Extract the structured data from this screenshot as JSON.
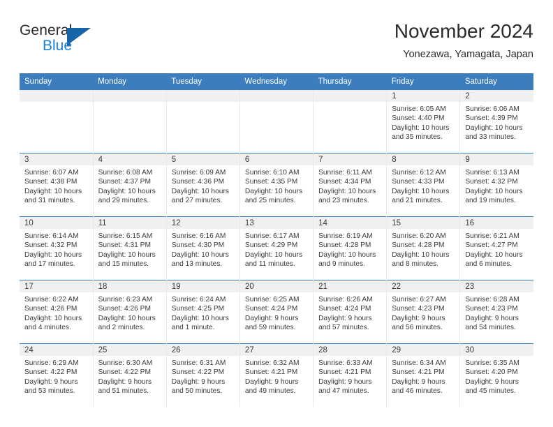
{
  "brand": {
    "name_top": "General",
    "name_bottom": "Blue",
    "mark": "triangle-logo"
  },
  "header": {
    "title": "November 2024",
    "subtitle": "Yonezawa, Yamagata, Japan"
  },
  "colors": {
    "header_blue": "#3b7dbd",
    "brand_blue": "#1b7fd4",
    "mark_blue": "#1565a8",
    "daynum_band": "#f0f0f0"
  },
  "weekday_headers": [
    "Sunday",
    "Monday",
    "Tuesday",
    "Wednesday",
    "Thursday",
    "Friday",
    "Saturday"
  ],
  "labels": {
    "sunrise_prefix": "Sunrise:",
    "sunset_prefix": "Sunset:",
    "daylight_prefix": "Daylight:"
  },
  "weeks": [
    [
      {
        "empty": true
      },
      {
        "empty": true
      },
      {
        "empty": true
      },
      {
        "empty": true
      },
      {
        "empty": true
      },
      {
        "day": "1",
        "sunrise": "Sunrise: 6:05 AM",
        "sunset": "Sunset: 4:40 PM",
        "daylight_1": "Daylight: 10 hours",
        "daylight_2": "and 35 minutes."
      },
      {
        "day": "2",
        "sunrise": "Sunrise: 6:06 AM",
        "sunset": "Sunset: 4:39 PM",
        "daylight_1": "Daylight: 10 hours",
        "daylight_2": "and 33 minutes."
      }
    ],
    [
      {
        "day": "3",
        "sunrise": "Sunrise: 6:07 AM",
        "sunset": "Sunset: 4:38 PM",
        "daylight_1": "Daylight: 10 hours",
        "daylight_2": "and 31 minutes."
      },
      {
        "day": "4",
        "sunrise": "Sunrise: 6:08 AM",
        "sunset": "Sunset: 4:37 PM",
        "daylight_1": "Daylight: 10 hours",
        "daylight_2": "and 29 minutes."
      },
      {
        "day": "5",
        "sunrise": "Sunrise: 6:09 AM",
        "sunset": "Sunset: 4:36 PM",
        "daylight_1": "Daylight: 10 hours",
        "daylight_2": "and 27 minutes."
      },
      {
        "day": "6",
        "sunrise": "Sunrise: 6:10 AM",
        "sunset": "Sunset: 4:35 PM",
        "daylight_1": "Daylight: 10 hours",
        "daylight_2": "and 25 minutes."
      },
      {
        "day": "7",
        "sunrise": "Sunrise: 6:11 AM",
        "sunset": "Sunset: 4:34 PM",
        "daylight_1": "Daylight: 10 hours",
        "daylight_2": "and 23 minutes."
      },
      {
        "day": "8",
        "sunrise": "Sunrise: 6:12 AM",
        "sunset": "Sunset: 4:33 PM",
        "daylight_1": "Daylight: 10 hours",
        "daylight_2": "and 21 minutes."
      },
      {
        "day": "9",
        "sunrise": "Sunrise: 6:13 AM",
        "sunset": "Sunset: 4:32 PM",
        "daylight_1": "Daylight: 10 hours",
        "daylight_2": "and 19 minutes."
      }
    ],
    [
      {
        "day": "10",
        "sunrise": "Sunrise: 6:14 AM",
        "sunset": "Sunset: 4:32 PM",
        "daylight_1": "Daylight: 10 hours",
        "daylight_2": "and 17 minutes."
      },
      {
        "day": "11",
        "sunrise": "Sunrise: 6:15 AM",
        "sunset": "Sunset: 4:31 PM",
        "daylight_1": "Daylight: 10 hours",
        "daylight_2": "and 15 minutes."
      },
      {
        "day": "12",
        "sunrise": "Sunrise: 6:16 AM",
        "sunset": "Sunset: 4:30 PM",
        "daylight_1": "Daylight: 10 hours",
        "daylight_2": "and 13 minutes."
      },
      {
        "day": "13",
        "sunrise": "Sunrise: 6:17 AM",
        "sunset": "Sunset: 4:29 PM",
        "daylight_1": "Daylight: 10 hours",
        "daylight_2": "and 11 minutes."
      },
      {
        "day": "14",
        "sunrise": "Sunrise: 6:19 AM",
        "sunset": "Sunset: 4:28 PM",
        "daylight_1": "Daylight: 10 hours",
        "daylight_2": "and 9 minutes."
      },
      {
        "day": "15",
        "sunrise": "Sunrise: 6:20 AM",
        "sunset": "Sunset: 4:28 PM",
        "daylight_1": "Daylight: 10 hours",
        "daylight_2": "and 8 minutes."
      },
      {
        "day": "16",
        "sunrise": "Sunrise: 6:21 AM",
        "sunset": "Sunset: 4:27 PM",
        "daylight_1": "Daylight: 10 hours",
        "daylight_2": "and 6 minutes."
      }
    ],
    [
      {
        "day": "17",
        "sunrise": "Sunrise: 6:22 AM",
        "sunset": "Sunset: 4:26 PM",
        "daylight_1": "Daylight: 10 hours",
        "daylight_2": "and 4 minutes."
      },
      {
        "day": "18",
        "sunrise": "Sunrise: 6:23 AM",
        "sunset": "Sunset: 4:26 PM",
        "daylight_1": "Daylight: 10 hours",
        "daylight_2": "and 2 minutes."
      },
      {
        "day": "19",
        "sunrise": "Sunrise: 6:24 AM",
        "sunset": "Sunset: 4:25 PM",
        "daylight_1": "Daylight: 10 hours",
        "daylight_2": "and 1 minute."
      },
      {
        "day": "20",
        "sunrise": "Sunrise: 6:25 AM",
        "sunset": "Sunset: 4:24 PM",
        "daylight_1": "Daylight: 9 hours",
        "daylight_2": "and 59 minutes."
      },
      {
        "day": "21",
        "sunrise": "Sunrise: 6:26 AM",
        "sunset": "Sunset: 4:24 PM",
        "daylight_1": "Daylight: 9 hours",
        "daylight_2": "and 57 minutes."
      },
      {
        "day": "22",
        "sunrise": "Sunrise: 6:27 AM",
        "sunset": "Sunset: 4:23 PM",
        "daylight_1": "Daylight: 9 hours",
        "daylight_2": "and 56 minutes."
      },
      {
        "day": "23",
        "sunrise": "Sunrise: 6:28 AM",
        "sunset": "Sunset: 4:23 PM",
        "daylight_1": "Daylight: 9 hours",
        "daylight_2": "and 54 minutes."
      }
    ],
    [
      {
        "day": "24",
        "sunrise": "Sunrise: 6:29 AM",
        "sunset": "Sunset: 4:22 PM",
        "daylight_1": "Daylight: 9 hours",
        "daylight_2": "and 53 minutes."
      },
      {
        "day": "25",
        "sunrise": "Sunrise: 6:30 AM",
        "sunset": "Sunset: 4:22 PM",
        "daylight_1": "Daylight: 9 hours",
        "daylight_2": "and 51 minutes."
      },
      {
        "day": "26",
        "sunrise": "Sunrise: 6:31 AM",
        "sunset": "Sunset: 4:22 PM",
        "daylight_1": "Daylight: 9 hours",
        "daylight_2": "and 50 minutes."
      },
      {
        "day": "27",
        "sunrise": "Sunrise: 6:32 AM",
        "sunset": "Sunset: 4:21 PM",
        "daylight_1": "Daylight: 9 hours",
        "daylight_2": "and 49 minutes."
      },
      {
        "day": "28",
        "sunrise": "Sunrise: 6:33 AM",
        "sunset": "Sunset: 4:21 PM",
        "daylight_1": "Daylight: 9 hours",
        "daylight_2": "and 47 minutes."
      },
      {
        "day": "29",
        "sunrise": "Sunrise: 6:34 AM",
        "sunset": "Sunset: 4:21 PM",
        "daylight_1": "Daylight: 9 hours",
        "daylight_2": "and 46 minutes."
      },
      {
        "day": "30",
        "sunrise": "Sunrise: 6:35 AM",
        "sunset": "Sunset: 4:20 PM",
        "daylight_1": "Daylight: 9 hours",
        "daylight_2": "and 45 minutes."
      }
    ]
  ]
}
